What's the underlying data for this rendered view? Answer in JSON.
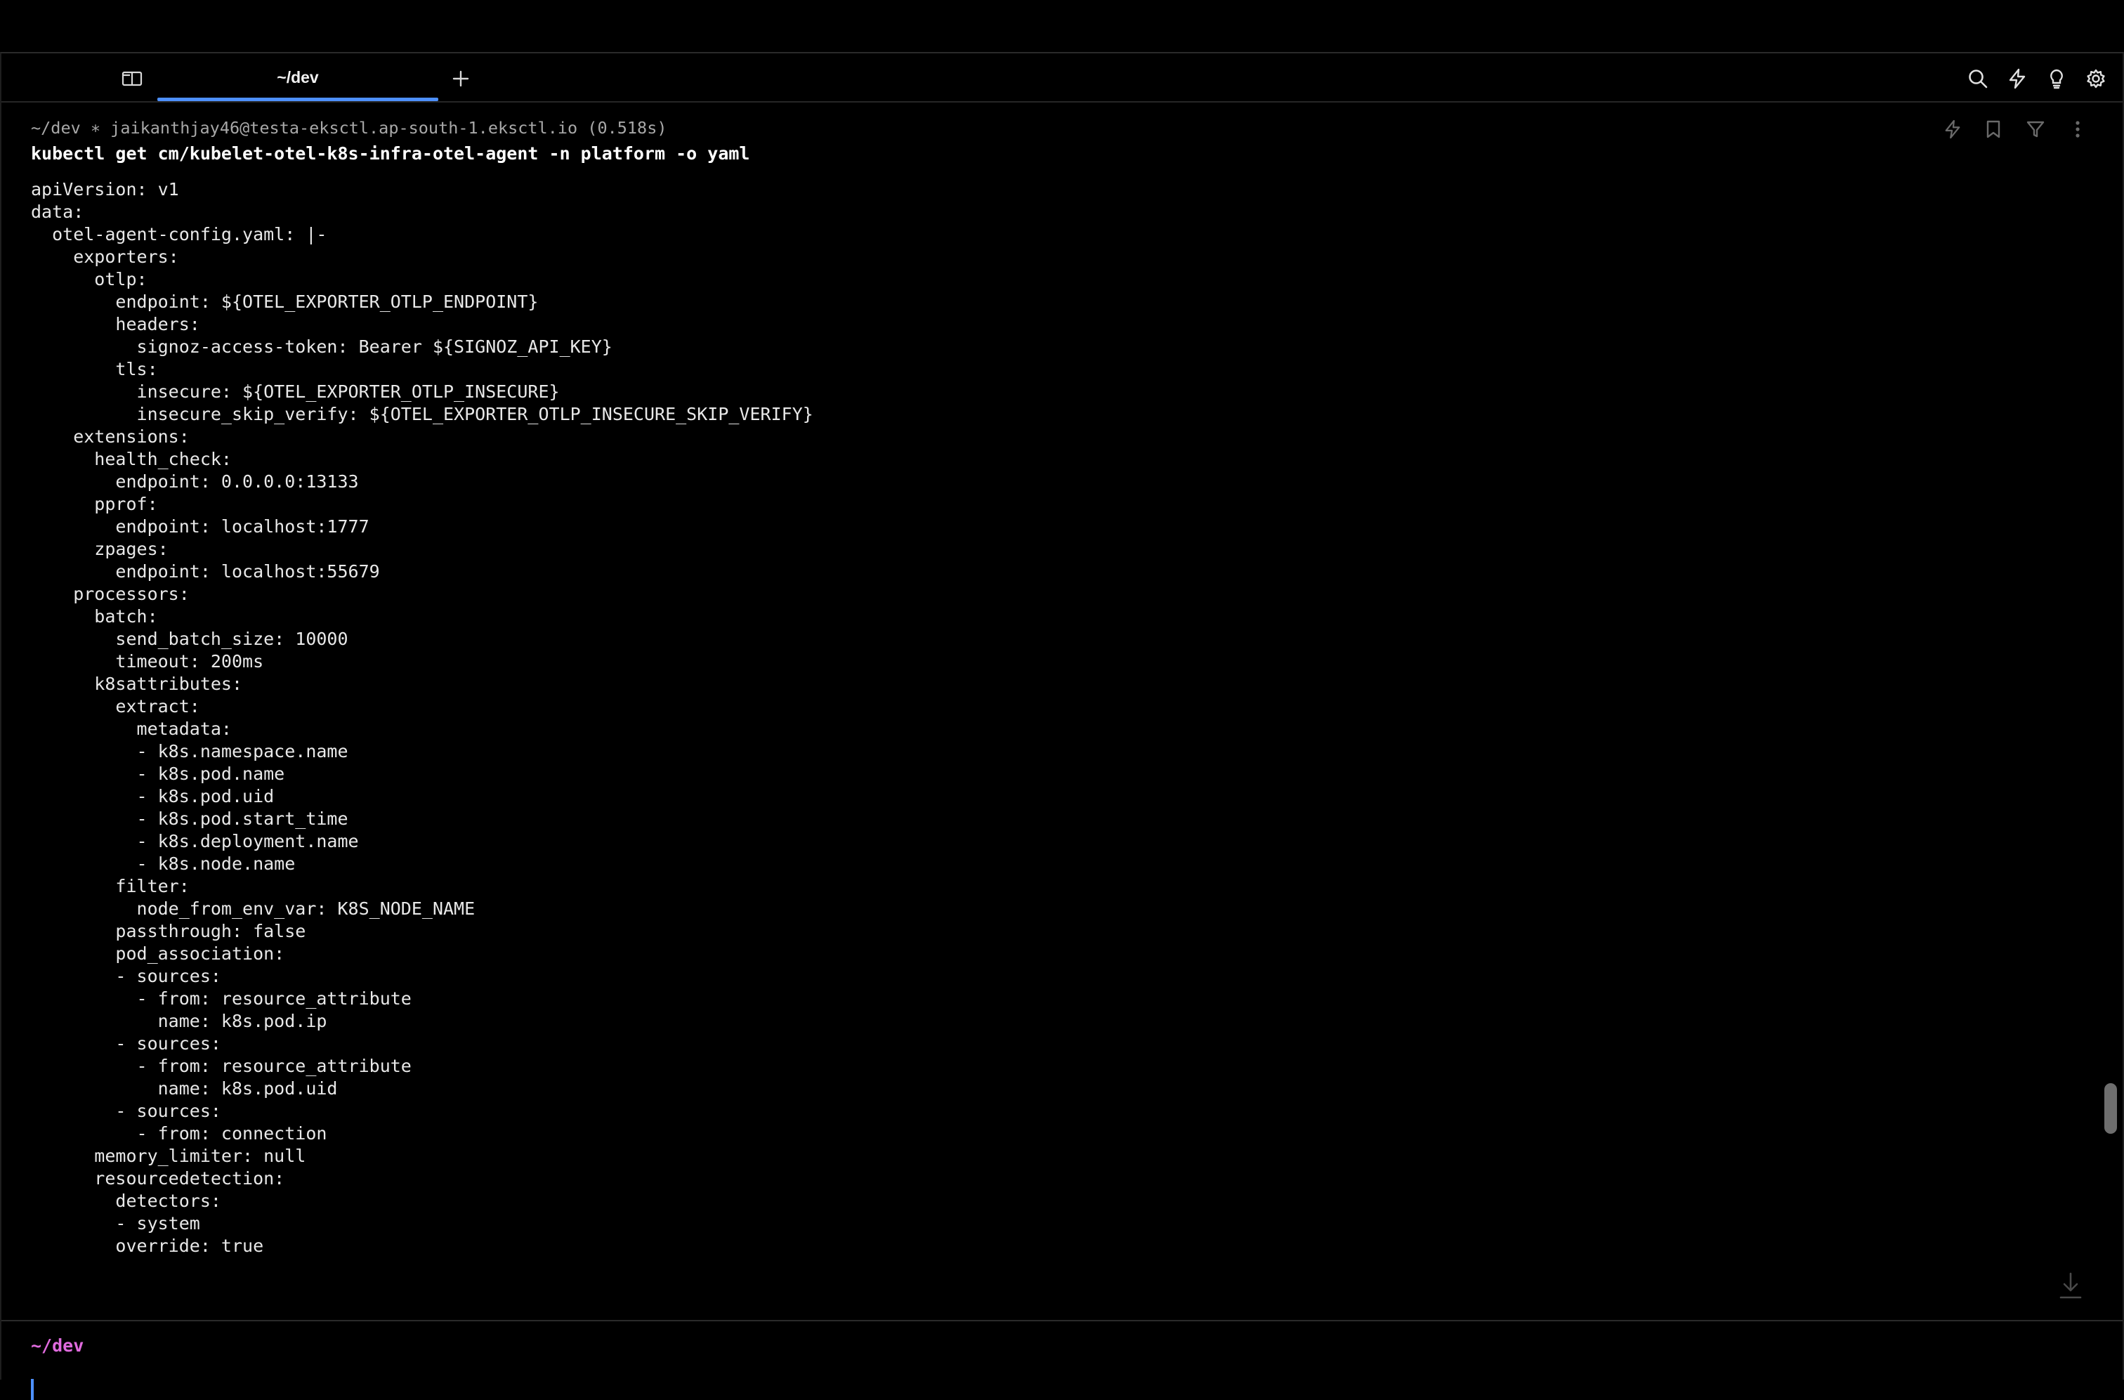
{
  "tabbar": {
    "active_tab_label": "~/dev",
    "icons": [
      "book-icon",
      "plus-icon",
      "search-icon",
      "lightning-icon",
      "lightbulb-icon",
      "gear-icon"
    ]
  },
  "block": {
    "meta": "~/dev ∗ jaikanthjay46@testa-eksctl.ap-south-1.eksctl.io (0.518s)",
    "command": "kubectl get cm/kubelet-otel-k8s-infra-otel-agent -n platform -o yaml",
    "action_icons": [
      "lightning-icon",
      "bookmark-icon",
      "filter-icon",
      "more-icon"
    ],
    "output": [
      "apiVersion: v1",
      "data:",
      "  otel-agent-config.yaml: |-",
      "    exporters:",
      "      otlp:",
      "        endpoint: ${OTEL_EXPORTER_OTLP_ENDPOINT}",
      "        headers:",
      "          signoz-access-token: Bearer ${SIGNOZ_API_KEY}",
      "        tls:",
      "          insecure: ${OTEL_EXPORTER_OTLP_INSECURE}",
      "          insecure_skip_verify: ${OTEL_EXPORTER_OTLP_INSECURE_SKIP_VERIFY}",
      "    extensions:",
      "      health_check:",
      "        endpoint: 0.0.0.0:13133",
      "      pprof:",
      "        endpoint: localhost:1777",
      "      zpages:",
      "        endpoint: localhost:55679",
      "    processors:",
      "      batch:",
      "        send_batch_size: 10000",
      "        timeout: 200ms",
      "      k8sattributes:",
      "        extract:",
      "          metadata:",
      "          - k8s.namespace.name",
      "          - k8s.pod.name",
      "          - k8s.pod.uid",
      "          - k8s.pod.start_time",
      "          - k8s.deployment.name",
      "          - k8s.node.name",
      "        filter:",
      "          node_from_env_var: K8S_NODE_NAME",
      "        passthrough: false",
      "        pod_association:",
      "        - sources:",
      "          - from: resource_attribute",
      "            name: k8s.pod.ip",
      "        - sources:",
      "          - from: resource_attribute",
      "            name: k8s.pod.uid",
      "        - sources:",
      "          - from: connection",
      "      memory_limiter: null",
      "      resourcedetection:",
      "        detectors:",
      "        - system",
      "        override: true"
    ]
  },
  "input": {
    "prompt": "~/dev"
  },
  "colors": {
    "background": "#000000",
    "accent": "#4d90ff",
    "prompt": "#e06bde",
    "meta_text": "#a8a8a8"
  }
}
